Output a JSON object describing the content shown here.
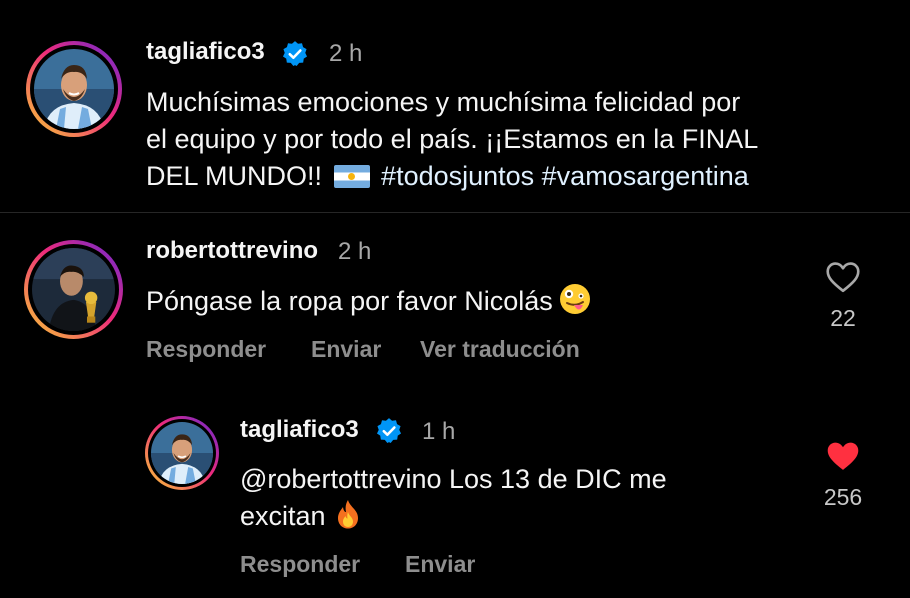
{
  "post": {
    "username": "tagliafico3",
    "time": "2 h",
    "caption_line1": "Muchísimas emociones y muchísima felicidad por",
    "caption_line2": "el equipo y por todo el país. ¡¡Estamos en la FINAL",
    "caption_line3_start": "DEL MUNDO!!",
    "caption_line3_tags": "#todosjuntos #vamosargentina",
    "flag_icon": "argentina-flag-emoji"
  },
  "comment": {
    "username": "robertottrevino",
    "time": "2 h",
    "text": "Póngase la ropa por favor Nicolás",
    "emoji": "zany-face-emoji",
    "likes": "22",
    "liked": false,
    "actions": {
      "reply": "Responder",
      "send": "Enviar",
      "translate": "Ver traducción"
    }
  },
  "reply": {
    "username": "tagliafico3",
    "time": "1 h",
    "text_line1": "@robertottrevino Los 13 de DIC me",
    "text_line2": "excitan",
    "emoji": "fire-emoji",
    "likes": "256",
    "liked": true,
    "actions": {
      "reply": "Responder",
      "send": "Enviar"
    }
  },
  "colors": {
    "background": "#000000",
    "text": "#f5f5f5",
    "muted": "#a8a8a8",
    "verified_blue": "#0095f6",
    "like_red": "#ff3040"
  }
}
